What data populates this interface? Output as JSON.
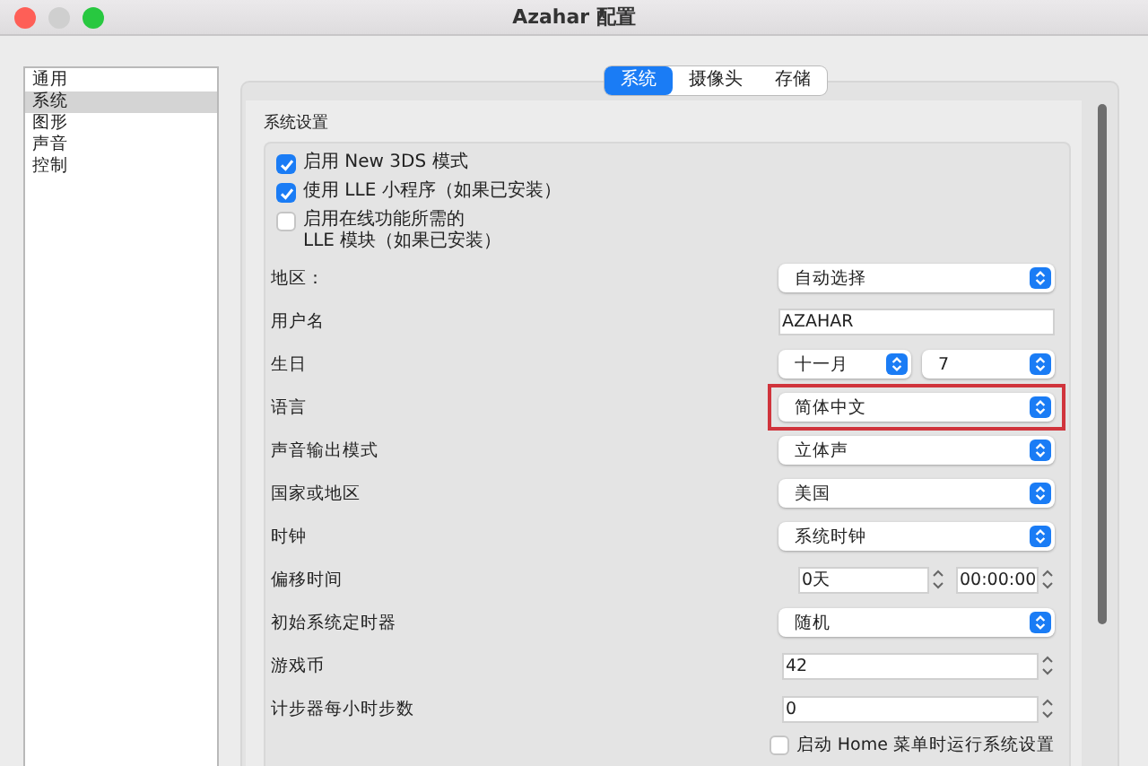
{
  "window": {
    "title": "Azahar 配置"
  },
  "sidebar": {
    "items": [
      {
        "label": "通用",
        "selected": false
      },
      {
        "label": "系统",
        "selected": true
      },
      {
        "label": "图形",
        "selected": false
      },
      {
        "label": "声音",
        "selected": false
      },
      {
        "label": "控制",
        "selected": false
      }
    ]
  },
  "tabs": [
    {
      "label": "系统",
      "selected": true
    },
    {
      "label": "摄像头",
      "selected": false
    },
    {
      "label": "存储",
      "selected": false
    }
  ],
  "group": {
    "title": "系统设置"
  },
  "options": [
    {
      "label": "启用 New 3DS 模式",
      "checked": true
    },
    {
      "label": "使用 LLE 小程序（如果已安装）",
      "checked": true
    },
    {
      "label": "启用在线功能所需的\nLLE 模块（如果已安装）",
      "checked": false
    }
  ],
  "settings": [
    {
      "kind": "select",
      "label": "地区：",
      "value": "自动选择",
      "highlighted": false
    },
    {
      "kind": "text",
      "label": "用户名",
      "value": "AZAHAR"
    },
    {
      "kind": "date",
      "label": "生日",
      "values": [
        "十一月",
        "7"
      ]
    },
    {
      "kind": "select",
      "label": "语言",
      "value": "简体中文",
      "highlighted": true
    },
    {
      "kind": "select",
      "label": "声音输出模式",
      "value": "立体声",
      "highlighted": false
    },
    {
      "kind": "select",
      "label": "国家或地区",
      "value": "美国",
      "highlighted": false
    },
    {
      "kind": "select",
      "label": "时钟",
      "value": "系统时钟",
      "highlighted": false
    },
    {
      "kind": "spin_pair",
      "label": "偏移时间",
      "values": [
        "0天",
        "00:00:00"
      ]
    },
    {
      "kind": "select",
      "label": "初始系统定时器",
      "value": "随机",
      "highlighted": false
    },
    {
      "kind": "spin",
      "label": "游戏币",
      "value": "42"
    },
    {
      "kind": "spin",
      "label": "计步器每小时步数",
      "value": "0"
    },
    {
      "kind": "check",
      "label": "启动 Home 菜单时运行系统设置",
      "checked": false
    }
  ]
}
